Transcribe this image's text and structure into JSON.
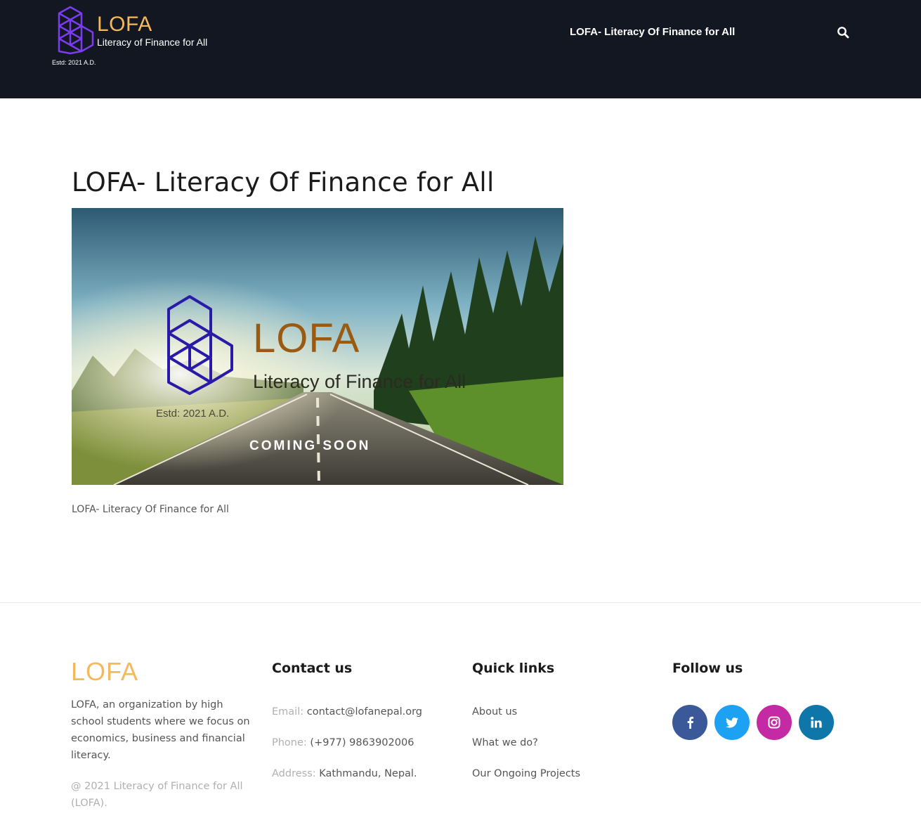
{
  "header": {
    "logo_word": "LOFA",
    "logo_tagline": "Literacy of Finance for All",
    "logo_estd": "Estd: 2021 A.D.",
    "nav_item": "LOFA- Literacy Of Finance for All",
    "search_icon": "search-icon"
  },
  "main": {
    "title": "LOFA- Literacy Of Finance for All",
    "hero": {
      "logo_word": "LOFA",
      "tagline": "Literacy of Finance for All",
      "estd": "Estd: 2021 A.D.",
      "coming_soon": "COMING SOON"
    },
    "caption": "LOFA- Literacy Of Finance for All"
  },
  "footer": {
    "logo_word": "LOFA",
    "about": "LOFA, an organization by high school students where we focus on economics, business and financial literacy.",
    "copyright": "@ 2021 Literacy of Finance for All (LOFA).",
    "contact": {
      "heading": "Contact us",
      "email_label": "Email:",
      "email": "contact@lofanepal.org",
      "phone_label": "Phone:",
      "phone": "(+977) 9863902006",
      "address_label": "Address:",
      "address": "Kathmandu, Nepal."
    },
    "quick_links": {
      "heading": "Quick links",
      "items": [
        "About us",
        "What we do?",
        "Our Ongoing Projects"
      ]
    },
    "follow": {
      "heading": "Follow us",
      "icons": [
        "facebook-icon",
        "twitter-icon",
        "instagram-icon",
        "linkedin-icon"
      ]
    }
  },
  "colors": {
    "header_bg": "#131722",
    "brand_gold": "#f4b95c",
    "brand_purple": "#6b2fd6",
    "facebook": "#3b5998",
    "twitter": "#1da1f2",
    "instagram": "#c32aa3",
    "linkedin": "#0e76a8"
  }
}
